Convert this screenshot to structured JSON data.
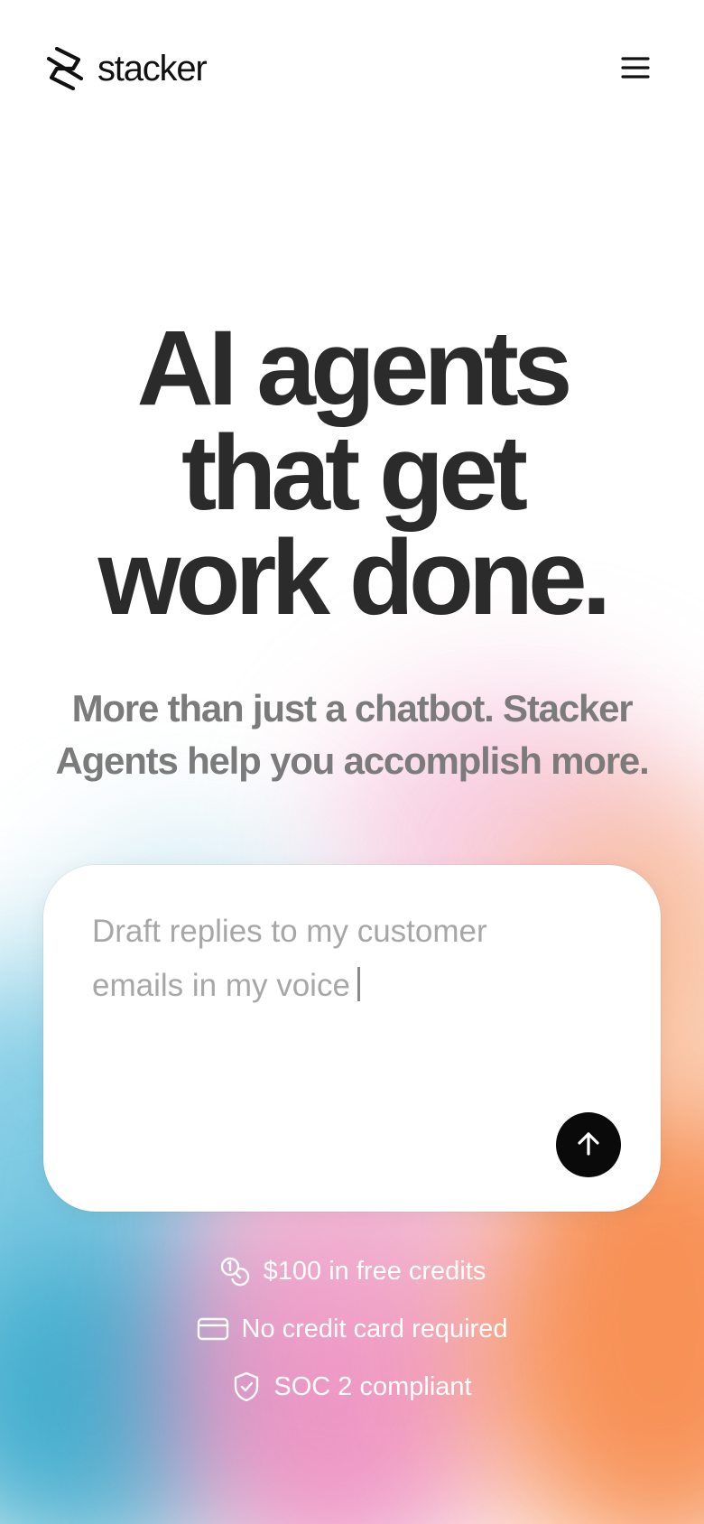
{
  "header": {
    "brand_name": "stacker",
    "logo_icon": "stacker-logo-icon",
    "menu_icon": "hamburger-menu-icon"
  },
  "hero": {
    "title_lines": [
      "AI agents",
      "that get",
      "work done."
    ],
    "subtitle": "More than just a chatbot. Stacker Agents help you accomplish more."
  },
  "prompt": {
    "placeholder": "Draft replies to my customer emails in my voice",
    "send_icon": "arrow-up-icon"
  },
  "perks": [
    {
      "icon": "coins-icon",
      "label": "$100 in free credits"
    },
    {
      "icon": "credit-card-icon",
      "label": "No credit card required"
    },
    {
      "icon": "shield-check-icon",
      "label": "SOC 2 compliant"
    }
  ],
  "colors": {
    "title": "#2b2b2b",
    "subtitle": "#7b7b7b",
    "placeholder": "#a7a7a7",
    "send_button": "#0a0a0a",
    "gradient_blue": "#6cc3e0",
    "gradient_pink": "#ec86bb",
    "gradient_orange": "#f78c4e"
  }
}
